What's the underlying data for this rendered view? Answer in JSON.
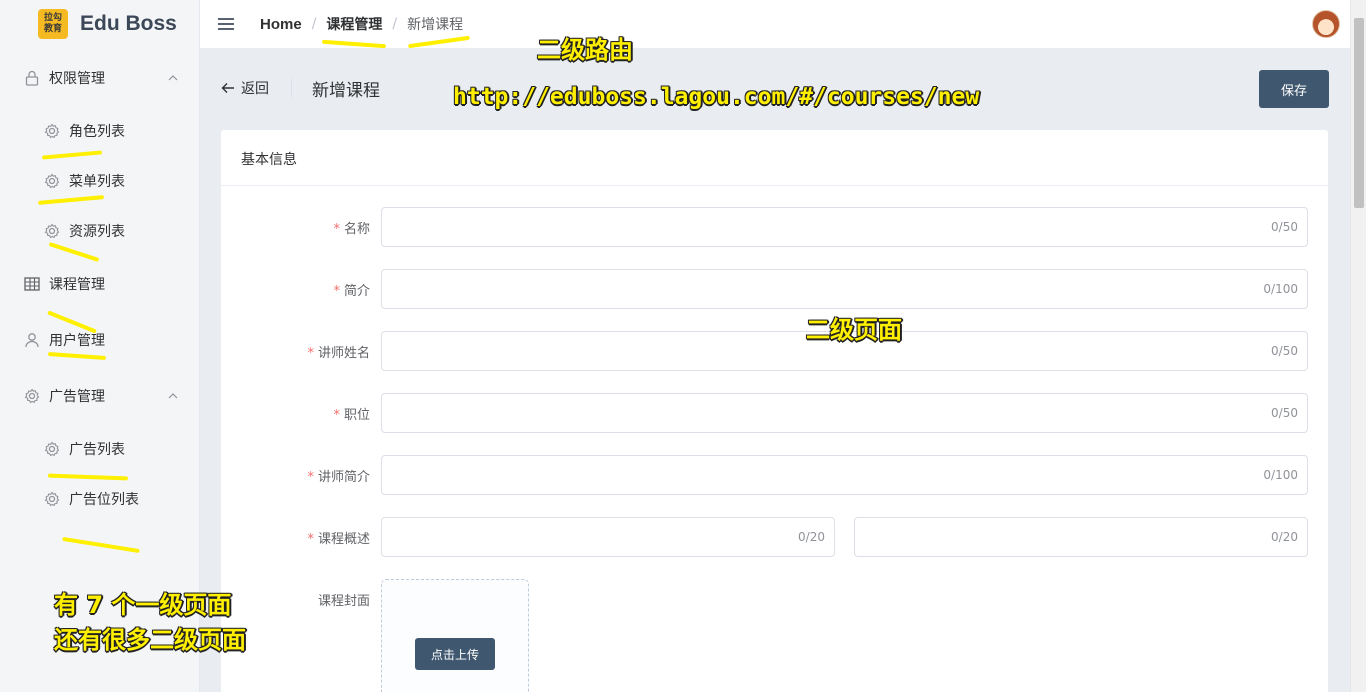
{
  "app": {
    "logo_mark_line1": "拉勾",
    "logo_mark_line2": "教育",
    "name": "Edu Boss"
  },
  "sidebar": {
    "items": [
      {
        "label": "权限管理",
        "icon": "lock-icon",
        "expandable": true
      },
      {
        "label": "角色列表",
        "icon": "gear-icon"
      },
      {
        "label": "菜单列表",
        "icon": "gear-icon"
      },
      {
        "label": "资源列表",
        "icon": "gear-icon"
      },
      {
        "label": "课程管理",
        "icon": "grid-icon"
      },
      {
        "label": "用户管理",
        "icon": "user-icon"
      },
      {
        "label": "广告管理",
        "icon": "gear-icon",
        "expandable": true
      },
      {
        "label": "广告列表",
        "icon": "gear-icon"
      },
      {
        "label": "广告位列表",
        "icon": "gear-icon"
      }
    ]
  },
  "header": {
    "breadcrumb": [
      "Home",
      "课程管理",
      "新增课程"
    ],
    "separator": "/"
  },
  "page": {
    "back_label": "返回",
    "title": "新增课程",
    "save_label": "保存"
  },
  "card": {
    "title": "基本信息",
    "fields": [
      {
        "label": "名称",
        "required": true,
        "value": "",
        "count": "0/50"
      },
      {
        "label": "简介",
        "required": true,
        "value": "",
        "count": "0/100"
      },
      {
        "label": "讲师姓名",
        "required": true,
        "value": "",
        "count": "0/50"
      },
      {
        "label": "职位",
        "required": true,
        "value": "",
        "count": "0/50"
      },
      {
        "label": "讲师简介",
        "required": true,
        "value": "",
        "count": "0/100"
      },
      {
        "label": "课程概述",
        "required": true,
        "value": "",
        "count": "0/20",
        "count2": "0/20"
      }
    ],
    "cover_label": "课程封面",
    "upload_label": "点击上传",
    "required_mark": "*"
  },
  "annotations": {
    "route_level": "二级路由",
    "url": "http://eduboss.lagou.com/#/courses/new",
    "page_level": "二级页面",
    "note_line1": "有 7 个一级页面",
    "note_line2": "还有很多二级页面"
  },
  "colors": {
    "primary_button": "#40586f",
    "required": "#f56c6c",
    "highlight": "#ffef00",
    "sidebar_bg": "#f4f5f7",
    "content_bg": "#e9edf1"
  }
}
